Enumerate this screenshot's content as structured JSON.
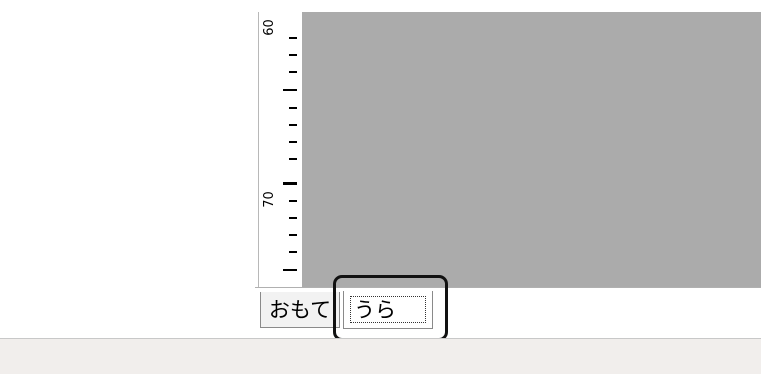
{
  "ruler": {
    "label_60": "60",
    "label_70": "70"
  },
  "tabs": [
    {
      "label": "おもて"
    },
    {
      "label": "うら"
    }
  ],
  "colors": {
    "canvas": "#ababab",
    "status_bar": "#f1eeec"
  }
}
